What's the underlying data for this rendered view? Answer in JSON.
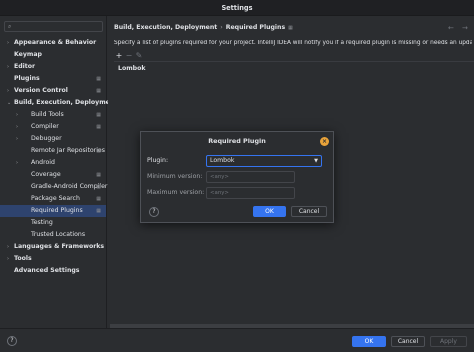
{
  "window": {
    "title": "Settings"
  },
  "sidebar": {
    "search": {
      "icon": "search-icon",
      "placeholder": ""
    },
    "items": [
      {
        "label": "Appearance & Behavior",
        "arrow": "›",
        "level": 0,
        "bold": true,
        "cfg": false
      },
      {
        "label": "Keymap",
        "arrow": "",
        "level": 0,
        "bold": true,
        "cfg": false
      },
      {
        "label": "Editor",
        "arrow": "›",
        "level": 0,
        "bold": true,
        "cfg": false
      },
      {
        "label": "Plugins",
        "arrow": "",
        "level": 0,
        "bold": true,
        "cfg": true
      },
      {
        "label": "Version Control",
        "arrow": "›",
        "level": 0,
        "bold": true,
        "cfg": true
      },
      {
        "label": "Build, Execution, Deployment",
        "arrow": "⌄",
        "level": 0,
        "bold": true,
        "cfg": false
      },
      {
        "label": "Build Tools",
        "arrow": "›",
        "level": 1,
        "bold": false,
        "cfg": true
      },
      {
        "label": "Compiler",
        "arrow": "›",
        "level": 1,
        "bold": false,
        "cfg": true
      },
      {
        "label": "Debugger",
        "arrow": "›",
        "level": 1,
        "bold": false,
        "cfg": false
      },
      {
        "label": "Remote Jar Repositories",
        "arrow": "",
        "level": 1,
        "bold": false,
        "cfg": true
      },
      {
        "label": "Android",
        "arrow": "›",
        "level": 1,
        "bold": false,
        "cfg": false
      },
      {
        "label": "Coverage",
        "arrow": "",
        "level": 1,
        "bold": false,
        "cfg": true
      },
      {
        "label": "Gradle-Android Compiler",
        "arrow": "",
        "level": 1,
        "bold": false,
        "cfg": true
      },
      {
        "label": "Package Search",
        "arrow": "",
        "level": 1,
        "bold": false,
        "cfg": true
      },
      {
        "label": "Required Plugins",
        "arrow": "",
        "level": 1,
        "bold": false,
        "cfg": true,
        "selected": true
      },
      {
        "label": "Testing",
        "arrow": "",
        "level": 1,
        "bold": false,
        "cfg": false
      },
      {
        "label": "Trusted Locations",
        "arrow": "",
        "level": 1,
        "bold": false,
        "cfg": false
      },
      {
        "label": "Languages & Frameworks",
        "arrow": "›",
        "level": 0,
        "bold": true,
        "cfg": false
      },
      {
        "label": "Tools",
        "arrow": "›",
        "level": 0,
        "bold": true,
        "cfg": false
      },
      {
        "label": "Advanced Settings",
        "arrow": "",
        "level": 0,
        "bold": true,
        "cfg": false
      }
    ]
  },
  "main": {
    "breadcrumb": {
      "parent": "Build, Execution, Deployment",
      "separator": "›",
      "current": "Required Plugins",
      "icon": "grid-icon"
    },
    "nav": {
      "back": "←",
      "forward": "→"
    },
    "description": "Specify a list of plugins required for your project. IntelliJ IDEA will notify you if a required plugin is missing or needs an update.",
    "toolbar": {
      "add": "+",
      "remove": "−",
      "edit": "✎"
    },
    "plugins": [
      "Lombok"
    ]
  },
  "dialog": {
    "title": "Required Plugin",
    "close_icon": "close-icon",
    "plugin_label": "Plugin:",
    "plugin_value": "Lombok",
    "min_label": "Minimum version:",
    "min_placeholder": "<any>",
    "max_label": "Maximum version:",
    "max_placeholder": "<any>",
    "help": "?",
    "ok": "OK",
    "cancel": "Cancel"
  },
  "footer": {
    "help": "?",
    "ok": "OK",
    "cancel": "Cancel",
    "apply": "Apply"
  },
  "colors": {
    "accent": "#3574f0",
    "selection": "#2e436e",
    "background": "#2b2d30",
    "close_badge": "#e8a33a"
  }
}
